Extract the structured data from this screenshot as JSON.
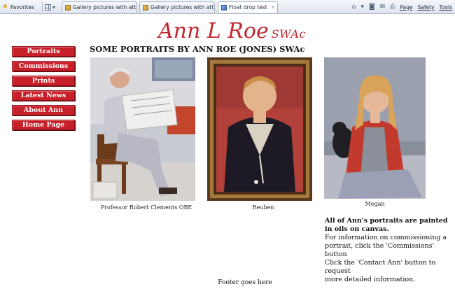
{
  "browser": {
    "favorites_label": "Favorites",
    "tabs": [
      {
        "title": "Gallery pictures with attac...",
        "active": false
      },
      {
        "title": "Gallery pictures with attac...",
        "active": false
      },
      {
        "title": "Float drop test",
        "active": true
      }
    ],
    "menus": [
      "Page",
      "Safety",
      "Tools"
    ]
  },
  "site": {
    "title": "Ann L Roe",
    "title_suffix": "SWAc",
    "accent_color": "#c0272d"
  },
  "nav": {
    "items": [
      {
        "label": "Portraits"
      },
      {
        "label": "Commissions"
      },
      {
        "label": "Prints"
      },
      {
        "label": "Latest News"
      },
      {
        "label": "About Ann"
      },
      {
        "label": "Home Page"
      }
    ]
  },
  "main": {
    "heading": "SOME PORTRAITS BY ANN ROE (JONES) SWAc",
    "portraits": [
      {
        "caption": "Professor Robert Clements OBE"
      },
      {
        "caption": "Reuben"
      },
      {
        "caption": "Megan"
      }
    ],
    "info": {
      "lead_line1": "All of Ann's portraits are painted",
      "lead_line2": "in oils on canvas.",
      "body_line1": "For information on commissioning a",
      "body_line2": "portrait, click the 'Commissions' button",
      "body_line3": "Click the 'Contact Ann' button to request",
      "body_line4": "more detailed information."
    }
  },
  "footer": {
    "text": "Footer goes here"
  }
}
